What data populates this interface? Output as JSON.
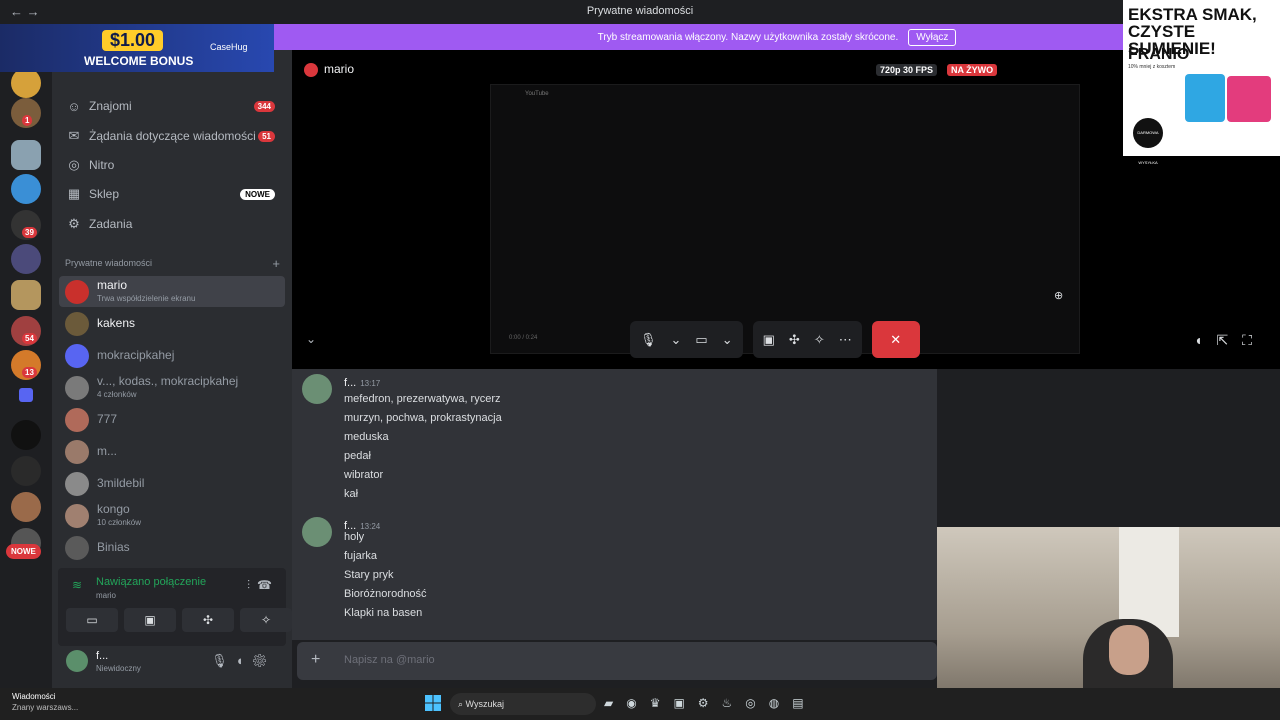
{
  "window": {
    "title": "Prywatne wiadomości",
    "nav": "← →"
  },
  "banner": {
    "text": "Tryb streamowania włączony. Nazwy użytkownika zostały skrócone.",
    "button": "Wyłącz"
  },
  "guilds": {
    "badges": [
      "1",
      "39",
      "54",
      "13"
    ],
    "new_label": "NOWE"
  },
  "sidebar": {
    "items": [
      {
        "label": "Znajomi",
        "badge": "344",
        "icon": "friends-icon"
      },
      {
        "label": "Żądania dotyczące wiadomości",
        "badge": "51",
        "icon": "mail-icon"
      },
      {
        "label": "Nitro",
        "badge": "",
        "icon": "nitro-icon"
      },
      {
        "label": "Sklep",
        "badge": "NOWE",
        "icon": "shop-icon"
      },
      {
        "label": "Zadania",
        "badge": "",
        "icon": "quests-icon"
      }
    ],
    "dm_header": "Prywatne wiadomości",
    "dms": [
      {
        "name": "mario",
        "sub": "Trwa współdzielenie ekranu",
        "active": true
      },
      {
        "name": "kakens",
        "sub": ""
      },
      {
        "name": "mokracipkahej",
        "sub": ""
      },
      {
        "name": "v..., kodas., mokracipkahej",
        "sub": "4 członków"
      },
      {
        "name": "777",
        "sub": ""
      },
      {
        "name": "m...",
        "sub": ""
      },
      {
        "name": "3mildebil",
        "sub": ""
      },
      {
        "name": "kongo",
        "sub": "10 członków"
      },
      {
        "name": "Binias",
        "sub": ""
      }
    ]
  },
  "voice": {
    "status": "Nawiązano połączenie",
    "channel": "mario"
  },
  "user": {
    "name": "f...",
    "status": "Niewidoczny"
  },
  "stream": {
    "user": "mario",
    "quality": "720p 30 FPS",
    "live": "NA ŻYWO",
    "search_hint": "Wysz",
    "screen_app": "YouTube",
    "screen_user": "mario",
    "time": "0:00 / 0:24"
  },
  "messages": [
    {
      "author": "f...",
      "time": "13:17",
      "lines": [
        "mefedron, prezerwatywa, rycerz",
        "murzyn, pochwa,  prokrastynacja",
        "meduska",
        "pedał",
        "wibrator",
        "kał"
      ]
    },
    {
      "author": "f...",
      "time": "13:24",
      "lines": [
        "holy",
        "fujarka",
        "Stary pryk",
        "Bioróżnorodność",
        "Klapki na basen"
      ]
    }
  ],
  "composer": {
    "placeholder": "Napisz na @mario"
  },
  "taskbar": {
    "notif_title": "Wiadomości",
    "notif_sub": "Znany warszaws...",
    "search": "Wyszukaj"
  },
  "ads": {
    "casino": {
      "amount": "$1.00",
      "text": "WELCOME BONUS",
      "brand": "CaseHug"
    },
    "franio": {
      "line1": "EKSTRA SMAK,",
      "line2": "CZYSTE SUMIENIE!",
      "brand": "FRANIO",
      "small": "10% mniej z kosztem",
      "badge": "DARMOWA WYSYŁKA"
    }
  }
}
